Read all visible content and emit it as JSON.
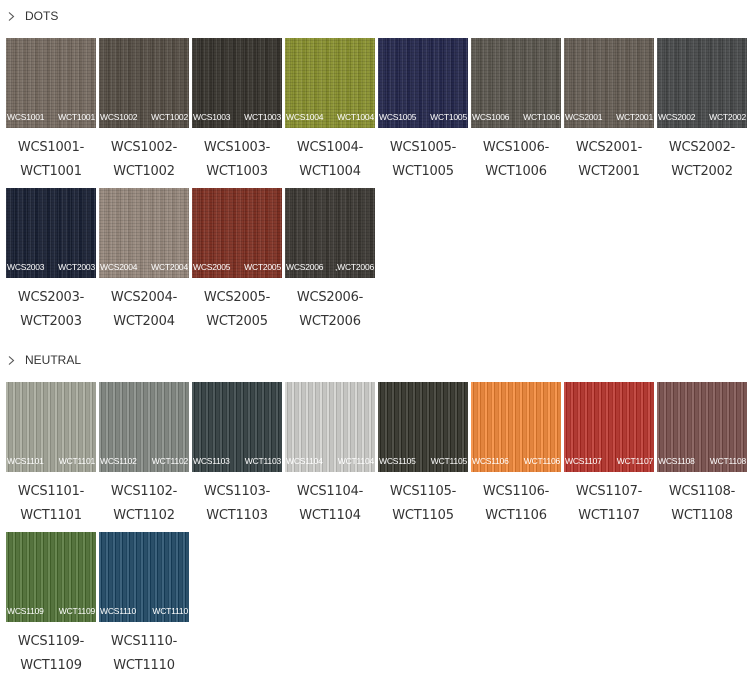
{
  "sections": [
    {
      "title": "DOTS",
      "items": [
        {
          "code_s": "WCS1001",
          "code_t": "WCT1001",
          "line1": "WCS1001-",
          "line2": "WCT1001",
          "color": "#7d7268",
          "pattern": "dots"
        },
        {
          "code_s": "WCS1002",
          "code_t": "WCT1002",
          "line1": "WCS1002-",
          "line2": "WCT1002",
          "color": "#5d564d",
          "pattern": "dots"
        },
        {
          "code_s": "WCS1003",
          "code_t": "WCT1003",
          "line1": "WCS1003-",
          "line2": "WCT1003",
          "color": "#3f3c36",
          "pattern": "dots"
        },
        {
          "code_s": "WCS1004",
          "code_t": "WCT1004",
          "line1": "WCS1004-",
          "line2": "WCT1004",
          "color": "#8e9638",
          "pattern": "dots"
        },
        {
          "code_s": "WCS1005",
          "code_t": "WCT1005",
          "line1": "WCS1005-",
          "line2": "WCT1005",
          "color": "#2e3155",
          "pattern": "dots"
        },
        {
          "code_s": "WCS1006",
          "code_t": "WCT1006",
          "line1": "WCS1006-",
          "line2": "WCT1006",
          "color": "#625e56",
          "pattern": "dots"
        },
        {
          "code_s": "WCS2001",
          "code_t": "WCT2001",
          "line1": "WCS2001-",
          "line2": "WCT2001",
          "color": "#6d655c",
          "pattern": "dots"
        },
        {
          "code_s": "WCS2002",
          "code_t": "WCT2002",
          "line1": "WCS2002-",
          "line2": "WCT2002",
          "color": "#4f5152",
          "pattern": "dots"
        },
        {
          "code_s": "WCS2003",
          "code_t": "WCT2003",
          "line1": "WCS2003-",
          "line2": "WCT2003",
          "color": "#232a3d",
          "pattern": "dots"
        },
        {
          "code_s": "WCS2004",
          "code_t": "WCT2004",
          "line1": "WCS2004-",
          "line2": "WCT2004",
          "color": "#9b8d82",
          "pattern": "dots"
        },
        {
          "code_s": "WCS2005",
          "code_t": "WCT2005",
          "line1": "WCS2005-",
          "line2": "WCT2005",
          "color": "#85392c",
          "pattern": "dots"
        },
        {
          "code_s": "WCS2006",
          "code_t": ",WCT2006",
          "line1": "WCS2006-",
          "line2": "WCT2006",
          "color": "#44413c",
          "pattern": "dots"
        }
      ]
    },
    {
      "title": "NEUTRAL",
      "items": [
        {
          "code_s": "WCS1101",
          "code_t": "WCT1101",
          "line1": "WCS1101-",
          "line2": "WCT1101",
          "color": "#9ea094",
          "pattern": "weave"
        },
        {
          "code_s": "WCS1102",
          "code_t": "WCT1102",
          "line1": "WCS1102-",
          "line2": "WCT1102",
          "color": "#808580",
          "pattern": "weave"
        },
        {
          "code_s": "WCS1103",
          "code_t": "WCT1103",
          "line1": "WCS1103-",
          "line2": "WCT1103",
          "color": "#3b4648",
          "pattern": "weave"
        },
        {
          "code_s": "WCS1104",
          "code_t": "WCT1104",
          "line1": "WCS1104-",
          "line2": "WCT1104",
          "color": "#c4c4c1",
          "pattern": "weave"
        },
        {
          "code_s": "WCS1105",
          "code_t": "WCT1105",
          "line1": "WCS1105-",
          "line2": "WCT1105",
          "color": "#3d3d35",
          "pattern": "weave"
        },
        {
          "code_s": "WCS1106",
          "code_t": "WCT1106",
          "line1": "WCS1106-",
          "line2": "WCT1106",
          "color": "#e2843e",
          "pattern": "weave"
        },
        {
          "code_s": "WCS1107",
          "code_t": "WCT1107",
          "line1": "WCS1107-",
          "line2": "WCT1107",
          "color": "#b03a33",
          "pattern": "weave"
        },
        {
          "code_s": "WCS1108",
          "code_t": "WCT1108",
          "line1": "WCS1108-",
          "line2": "WCT1108",
          "color": "#7a5552",
          "pattern": "weave"
        },
        {
          "code_s": "WCS1109",
          "code_t": "WCT1109",
          "line1": "WCS1109-",
          "line2": "WCT1109",
          "color": "#55733e",
          "pattern": "weave"
        },
        {
          "code_s": "WCS1110",
          "code_t": "WCT1110",
          "line1": "WCS1110-",
          "line2": "WCT1110",
          "color": "#2a4f69",
          "pattern": "weave"
        }
      ]
    }
  ]
}
